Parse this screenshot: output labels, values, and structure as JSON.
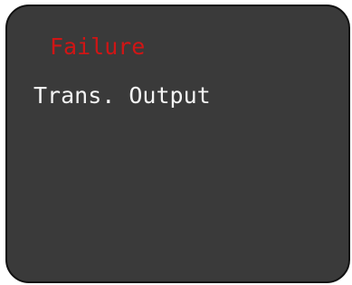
{
  "display": {
    "status_text": "Failure",
    "message_text": "Trans. Output",
    "colors": {
      "background": "#3a3a3a",
      "status": "#d01515",
      "message": "#f4f4f4",
      "border": "#111111"
    }
  }
}
